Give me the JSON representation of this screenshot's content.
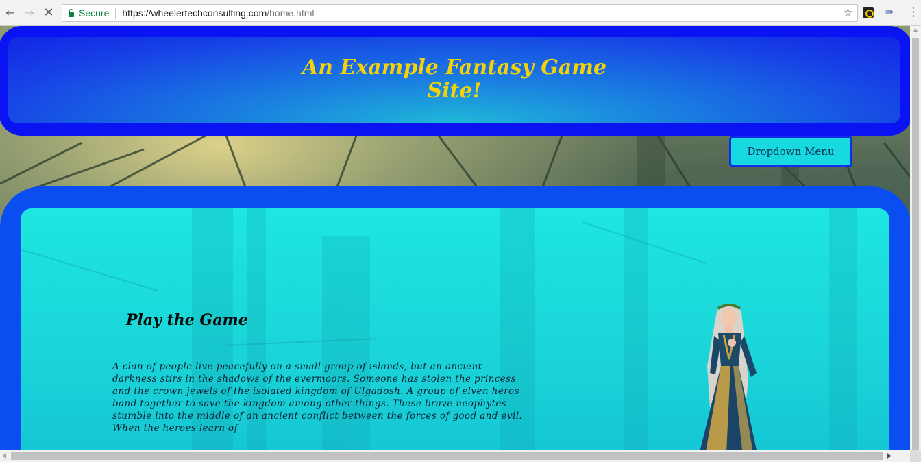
{
  "browser": {
    "back_icon": "arrow-left-icon",
    "forward_icon": "arrow-right-icon",
    "stop_icon": "close-icon",
    "secure_label": "Secure",
    "url_host": "https://wheelertechconsulting.com",
    "url_path": "/home.html",
    "bookmark_icon": "star-icon",
    "menu_icon": "kebab-icon"
  },
  "site": {
    "title": "An Example Fantasy Game Site!",
    "dropdown_label": "Dropdown Menu",
    "colors": {
      "header_border": "#0a14f2",
      "title_color": "#f4d20a",
      "content_border": "#0a4ef2",
      "content_fill": "#1ad4d8",
      "button_fill": "#18d8e0"
    }
  },
  "main": {
    "heading": "Play the Game",
    "story": "A clan of people live peacefully on a small group of islands, but an ancient darkness stirs in the shadows of the evermoors. Someone has stolen the princess and the crown jewels of the isolated kingdom of Ulgadosh. A group of elven heros band together to save the kingdom among other things. These brave neophytes stumble into the middle of an ancient conflict between the forces of good and evil. When the heroes learn of"
  }
}
